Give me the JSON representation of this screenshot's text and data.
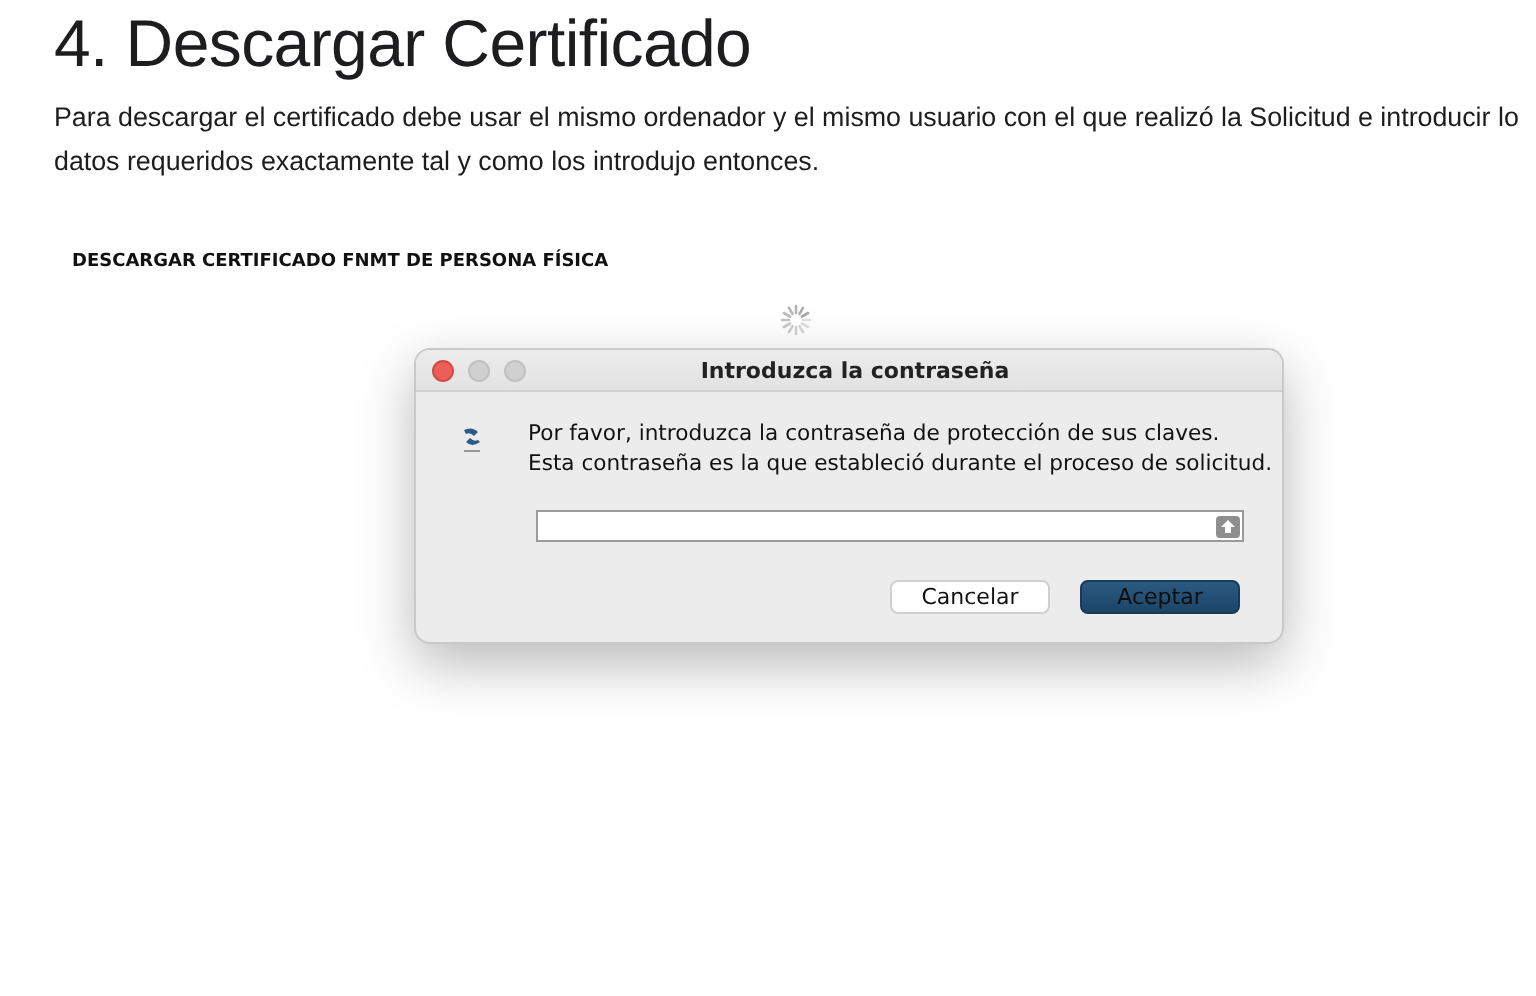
{
  "heading": "4. Descargar Certificado",
  "intro": {
    "lines": [
      "Para descargar el certificado debe usar el mismo ordenador y el mismo usuario con el que realizó la Solicitud e introducir lo",
      "datos requeridos exactamente tal y como los introdujo entonces."
    ]
  },
  "subheading": "DESCARGAR CERTIFICADO FNMT DE PERSONA FÍSICA",
  "dialog": {
    "title": "Introduzca la contraseña",
    "message_lines": [
      "Por favor, introduzca la contraseña de protección de sus claves.",
      "Esta contraseña es la que estableció durante el proceso de solicitud."
    ],
    "buttons": [
      {
        "label": "Cancelar",
        "kind": "secondary"
      },
      {
        "label": "Aceptar",
        "kind": "primary"
      }
    ]
  }
}
